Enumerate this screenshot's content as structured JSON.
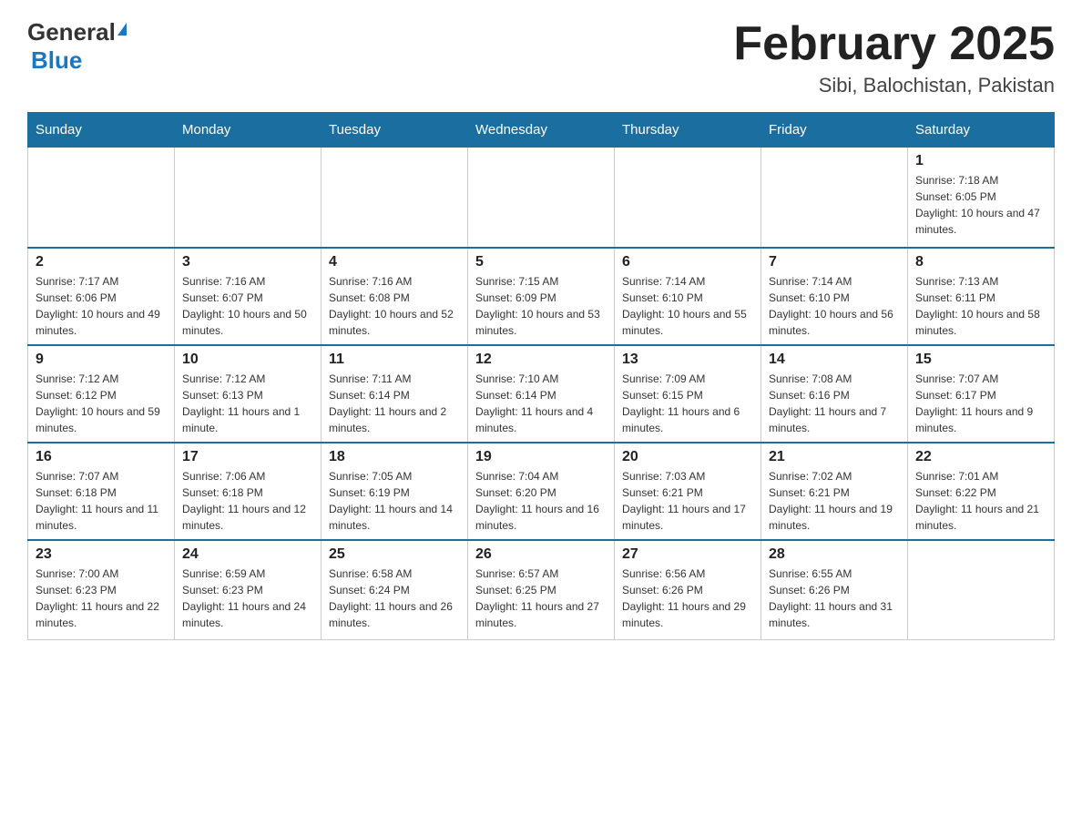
{
  "logo": {
    "general": "General",
    "blue": "Blue"
  },
  "title": "February 2025",
  "location": "Sibi, Balochistan, Pakistan",
  "days_header": [
    "Sunday",
    "Monday",
    "Tuesday",
    "Wednesday",
    "Thursday",
    "Friday",
    "Saturday"
  ],
  "weeks": [
    [
      {
        "day": "",
        "sunrise": "",
        "sunset": "",
        "daylight": ""
      },
      {
        "day": "",
        "sunrise": "",
        "sunset": "",
        "daylight": ""
      },
      {
        "day": "",
        "sunrise": "",
        "sunset": "",
        "daylight": ""
      },
      {
        "day": "",
        "sunrise": "",
        "sunset": "",
        "daylight": ""
      },
      {
        "day": "",
        "sunrise": "",
        "sunset": "",
        "daylight": ""
      },
      {
        "day": "",
        "sunrise": "",
        "sunset": "",
        "daylight": ""
      },
      {
        "day": "1",
        "sunrise": "Sunrise: 7:18 AM",
        "sunset": "Sunset: 6:05 PM",
        "daylight": "Daylight: 10 hours and 47 minutes."
      }
    ],
    [
      {
        "day": "2",
        "sunrise": "Sunrise: 7:17 AM",
        "sunset": "Sunset: 6:06 PM",
        "daylight": "Daylight: 10 hours and 49 minutes."
      },
      {
        "day": "3",
        "sunrise": "Sunrise: 7:16 AM",
        "sunset": "Sunset: 6:07 PM",
        "daylight": "Daylight: 10 hours and 50 minutes."
      },
      {
        "day": "4",
        "sunrise": "Sunrise: 7:16 AM",
        "sunset": "Sunset: 6:08 PM",
        "daylight": "Daylight: 10 hours and 52 minutes."
      },
      {
        "day": "5",
        "sunrise": "Sunrise: 7:15 AM",
        "sunset": "Sunset: 6:09 PM",
        "daylight": "Daylight: 10 hours and 53 minutes."
      },
      {
        "day": "6",
        "sunrise": "Sunrise: 7:14 AM",
        "sunset": "Sunset: 6:10 PM",
        "daylight": "Daylight: 10 hours and 55 minutes."
      },
      {
        "day": "7",
        "sunrise": "Sunrise: 7:14 AM",
        "sunset": "Sunset: 6:10 PM",
        "daylight": "Daylight: 10 hours and 56 minutes."
      },
      {
        "day": "8",
        "sunrise": "Sunrise: 7:13 AM",
        "sunset": "Sunset: 6:11 PM",
        "daylight": "Daylight: 10 hours and 58 minutes."
      }
    ],
    [
      {
        "day": "9",
        "sunrise": "Sunrise: 7:12 AM",
        "sunset": "Sunset: 6:12 PM",
        "daylight": "Daylight: 10 hours and 59 minutes."
      },
      {
        "day": "10",
        "sunrise": "Sunrise: 7:12 AM",
        "sunset": "Sunset: 6:13 PM",
        "daylight": "Daylight: 11 hours and 1 minute."
      },
      {
        "day": "11",
        "sunrise": "Sunrise: 7:11 AM",
        "sunset": "Sunset: 6:14 PM",
        "daylight": "Daylight: 11 hours and 2 minutes."
      },
      {
        "day": "12",
        "sunrise": "Sunrise: 7:10 AM",
        "sunset": "Sunset: 6:14 PM",
        "daylight": "Daylight: 11 hours and 4 minutes."
      },
      {
        "day": "13",
        "sunrise": "Sunrise: 7:09 AM",
        "sunset": "Sunset: 6:15 PM",
        "daylight": "Daylight: 11 hours and 6 minutes."
      },
      {
        "day": "14",
        "sunrise": "Sunrise: 7:08 AM",
        "sunset": "Sunset: 6:16 PM",
        "daylight": "Daylight: 11 hours and 7 minutes."
      },
      {
        "day": "15",
        "sunrise": "Sunrise: 7:07 AM",
        "sunset": "Sunset: 6:17 PM",
        "daylight": "Daylight: 11 hours and 9 minutes."
      }
    ],
    [
      {
        "day": "16",
        "sunrise": "Sunrise: 7:07 AM",
        "sunset": "Sunset: 6:18 PM",
        "daylight": "Daylight: 11 hours and 11 minutes."
      },
      {
        "day": "17",
        "sunrise": "Sunrise: 7:06 AM",
        "sunset": "Sunset: 6:18 PM",
        "daylight": "Daylight: 11 hours and 12 minutes."
      },
      {
        "day": "18",
        "sunrise": "Sunrise: 7:05 AM",
        "sunset": "Sunset: 6:19 PM",
        "daylight": "Daylight: 11 hours and 14 minutes."
      },
      {
        "day": "19",
        "sunrise": "Sunrise: 7:04 AM",
        "sunset": "Sunset: 6:20 PM",
        "daylight": "Daylight: 11 hours and 16 minutes."
      },
      {
        "day": "20",
        "sunrise": "Sunrise: 7:03 AM",
        "sunset": "Sunset: 6:21 PM",
        "daylight": "Daylight: 11 hours and 17 minutes."
      },
      {
        "day": "21",
        "sunrise": "Sunrise: 7:02 AM",
        "sunset": "Sunset: 6:21 PM",
        "daylight": "Daylight: 11 hours and 19 minutes."
      },
      {
        "day": "22",
        "sunrise": "Sunrise: 7:01 AM",
        "sunset": "Sunset: 6:22 PM",
        "daylight": "Daylight: 11 hours and 21 minutes."
      }
    ],
    [
      {
        "day": "23",
        "sunrise": "Sunrise: 7:00 AM",
        "sunset": "Sunset: 6:23 PM",
        "daylight": "Daylight: 11 hours and 22 minutes."
      },
      {
        "day": "24",
        "sunrise": "Sunrise: 6:59 AM",
        "sunset": "Sunset: 6:23 PM",
        "daylight": "Daylight: 11 hours and 24 minutes."
      },
      {
        "day": "25",
        "sunrise": "Sunrise: 6:58 AM",
        "sunset": "Sunset: 6:24 PM",
        "daylight": "Daylight: 11 hours and 26 minutes."
      },
      {
        "day": "26",
        "sunrise": "Sunrise: 6:57 AM",
        "sunset": "Sunset: 6:25 PM",
        "daylight": "Daylight: 11 hours and 27 minutes."
      },
      {
        "day": "27",
        "sunrise": "Sunrise: 6:56 AM",
        "sunset": "Sunset: 6:26 PM",
        "daylight": "Daylight: 11 hours and 29 minutes."
      },
      {
        "day": "28",
        "sunrise": "Sunrise: 6:55 AM",
        "sunset": "Sunset: 6:26 PM",
        "daylight": "Daylight: 11 hours and 31 minutes."
      },
      {
        "day": "",
        "sunrise": "",
        "sunset": "",
        "daylight": ""
      }
    ]
  ]
}
